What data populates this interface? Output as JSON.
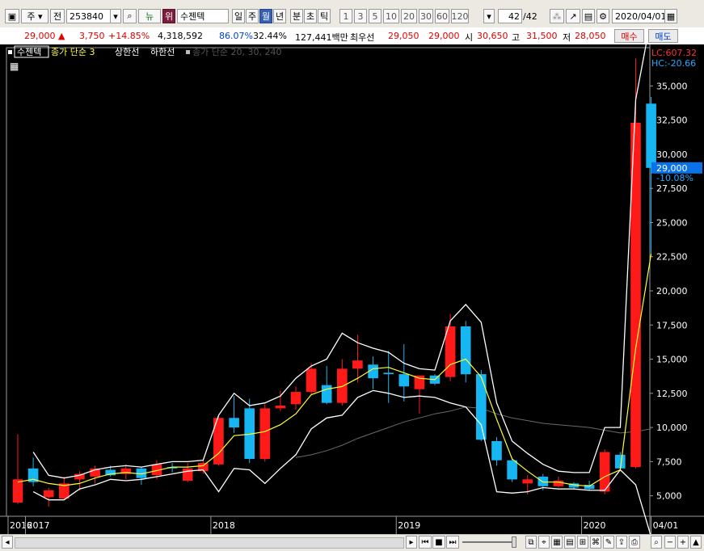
{
  "toolbar": {
    "period_type": "주",
    "prev_label": "전",
    "code": "253840",
    "news_label": "뉴",
    "flag_label": "위",
    "stock_name": "수젠텍",
    "periods": [
      "일",
      "주",
      "월",
      "년",
      "분",
      "초",
      "틱"
    ],
    "selected_period": "월",
    "numbers": [
      "1",
      "3",
      "5",
      "10",
      "20",
      "30",
      "60",
      "120"
    ],
    "count": "42",
    "count_total": "/42",
    "date": "2020/04/01"
  },
  "quote": {
    "price": "29,000",
    "change": "3,750",
    "change_pct": "+14.85%",
    "volume": "4,318,592",
    "ratio1": "86.07%",
    "ratio2": "32.44%",
    "amount": "127,441백만",
    "best_label": "최우선",
    "ask": "29,050",
    "bid": "29,000",
    "open_label": "시",
    "open": "30,650",
    "high_label": "고",
    "high": "31,500",
    "low_label": "저",
    "low": "28,050",
    "buy_label": "매수",
    "sell_label": "매도"
  },
  "colors": {
    "up": "#ff1a1a",
    "down": "#16b6f2",
    "ma": "#ffff33",
    "envelope": "#ffffff",
    "cursor_label_bg": "#0a72e8"
  },
  "chart_data": {
    "type": "candlestick",
    "legend": [
      "수젠텍",
      "종가 단순 3",
      "상한선",
      "하한선",
      "종가 단순 20, 30, 240"
    ],
    "lc_label": "LC:607.32",
    "hc_label": "HC:-20.66",
    "current_price_label": "29,000",
    "current_change_label": "-10.08%",
    "ylim": [
      3500,
      37800
    ],
    "y_ticks": [
      {
        "value": 5000,
        "label": "5,000"
      },
      {
        "value": 7500,
        "label": "7,500"
      },
      {
        "value": 10000,
        "label": "10,000"
      },
      {
        "value": 12500,
        "label": "12,500"
      },
      {
        "value": 15000,
        "label": "15,000"
      },
      {
        "value": 17500,
        "label": "17,500"
      },
      {
        "value": 20000,
        "label": "20,000"
      },
      {
        "value": 22500,
        "label": "22,500"
      },
      {
        "value": 25000,
        "label": "25,000"
      },
      {
        "value": 27500,
        "label": "27,500"
      },
      {
        "value": 30000,
        "label": "30,000"
      },
      {
        "value": 32500,
        "label": "32,500"
      },
      {
        "value": 35000,
        "label": "35,000"
      }
    ],
    "x_labels": [
      {
        "index": -1,
        "label": "2016"
      },
      {
        "index": 1,
        "label": "2017"
      },
      {
        "index": 13,
        "label": "2018"
      },
      {
        "index": 25,
        "label": "2019"
      },
      {
        "index": 37,
        "label": "2020"
      },
      {
        "index": 41.5,
        "label": "04/01"
      }
    ],
    "candles": [
      {
        "o": 4500,
        "h": 9500,
        "l": 4400,
        "c": 6200
      },
      {
        "o": 7000,
        "h": 7800,
        "l": 5700,
        "c": 6000
      },
      {
        "o": 4900,
        "h": 5600,
        "l": 4200,
        "c": 5400
      },
      {
        "o": 4800,
        "h": 6400,
        "l": 4700,
        "c": 5900
      },
      {
        "o": 6200,
        "h": 6800,
        "l": 5400,
        "c": 6600
      },
      {
        "o": 6400,
        "h": 7200,
        "l": 5900,
        "c": 7000
      },
      {
        "o": 6900,
        "h": 7200,
        "l": 6400,
        "c": 6500
      },
      {
        "o": 6600,
        "h": 7300,
        "l": 6200,
        "c": 7000
      },
      {
        "o": 7000,
        "h": 7100,
        "l": 5800,
        "c": 6300
      },
      {
        "o": 6500,
        "h": 7600,
        "l": 6200,
        "c": 7300
      },
      {
        "o": 7100,
        "h": 7400,
        "l": 6700,
        "c": 7000
      },
      {
        "o": 6100,
        "h": 7400,
        "l": 6000,
        "c": 7000
      },
      {
        "o": 6800,
        "h": 7600,
        "l": 6600,
        "c": 7400
      },
      {
        "o": 7300,
        "h": 10900,
        "l": 7200,
        "c": 10700
      },
      {
        "o": 10700,
        "h": 12300,
        "l": 9600,
        "c": 10000
      },
      {
        "o": 11400,
        "h": 12100,
        "l": 7400,
        "c": 7700
      },
      {
        "o": 7700,
        "h": 11700,
        "l": 7500,
        "c": 11400
      },
      {
        "o": 11400,
        "h": 12700,
        "l": 11200,
        "c": 11600
      },
      {
        "o": 11700,
        "h": 13000,
        "l": 11300,
        "c": 12600
      },
      {
        "o": 12600,
        "h": 14700,
        "l": 12400,
        "c": 14300
      },
      {
        "o": 13100,
        "h": 14500,
        "l": 11700,
        "c": 11800
      },
      {
        "o": 11800,
        "h": 15000,
        "l": 11600,
        "c": 14300
      },
      {
        "o": 14300,
        "h": 16800,
        "l": 13300,
        "c": 14900
      },
      {
        "o": 14600,
        "h": 15200,
        "l": 12800,
        "c": 13600
      },
      {
        "o": 14000,
        "h": 15600,
        "l": 11800,
        "c": 13900
      },
      {
        "o": 13900,
        "h": 16100,
        "l": 11900,
        "c": 13000
      },
      {
        "o": 12800,
        "h": 13800,
        "l": 11000,
        "c": 13800
      },
      {
        "o": 13800,
        "h": 13900,
        "l": 13100,
        "c": 13200
      },
      {
        "o": 13700,
        "h": 18300,
        "l": 13400,
        "c": 17400
      },
      {
        "o": 17400,
        "h": 17800,
        "l": 13300,
        "c": 13900
      },
      {
        "o": 13900,
        "h": 14200,
        "l": 9000,
        "c": 9100
      },
      {
        "o": 9000,
        "h": 9300,
        "l": 7200,
        "c": 7600
      },
      {
        "o": 7600,
        "h": 7800,
        "l": 6000,
        "c": 6200
      },
      {
        "o": 5900,
        "h": 6500,
        "l": 5100,
        "c": 6200
      },
      {
        "o": 6400,
        "h": 6600,
        "l": 5400,
        "c": 5700
      },
      {
        "o": 5700,
        "h": 6400,
        "l": 5600,
        "c": 6100
      },
      {
        "o": 5900,
        "h": 6000,
        "l": 5500,
        "c": 5600
      },
      {
        "o": 5800,
        "h": 6100,
        "l": 5400,
        "c": 5500
      },
      {
        "o": 5300,
        "h": 8400,
        "l": 5100,
        "c": 8200
      },
      {
        "o": 8000,
        "h": 8200,
        "l": 6800,
        "c": 7000
      },
      {
        "o": 7100,
        "h": 37000,
        "l": 7000,
        "c": 32300
      },
      {
        "o": 33700,
        "h": 34200,
        "l": 22700,
        "c": 29000
      }
    ],
    "ma3": [
      6000,
      6200,
      5900,
      5750,
      5900,
      6300,
      6600,
      6700,
      6600,
      6850,
      7100,
      7100,
      7200,
      8100,
      9400,
      9500,
      9700,
      10200,
      11000,
      12400,
      12800,
      13000,
      13600,
      14300,
      14400,
      14000,
      13600,
      13500,
      14600,
      15000,
      13700,
      10600,
      7700,
      6800,
      6000,
      6000,
      5800,
      5700,
      6400,
      6900,
      15800,
      22700
    ],
    "upper": [
      null,
      8200,
      6500,
      6300,
      6500,
      6900,
      7100,
      7200,
      7100,
      7300,
      7500,
      7500,
      7600,
      10900,
      12500,
      11600,
      11800,
      12300,
      13600,
      14500,
      15000,
      16900,
      16200,
      15800,
      15500,
      14700,
      14300,
      14200,
      17800,
      19000,
      17700,
      11800,
      9000,
      8100,
      7300,
      6800,
      6700,
      6700,
      10000,
      10000,
      34000,
      40000
    ],
    "lower": [
      null,
      5300,
      4700,
      4700,
      5500,
      5800,
      6200,
      6100,
      6200,
      6400,
      6600,
      6800,
      6900,
      5300,
      7000,
      6900,
      5900,
      7000,
      8000,
      9900,
      10700,
      10900,
      12200,
      12700,
      12500,
      12200,
      12300,
      12200,
      11800,
      11500,
      10200,
      5300,
      5200,
      5300,
      5600,
      5500,
      5500,
      5400,
      5400,
      6900,
      5800,
      2000
    ],
    "slow_ma": [
      null,
      null,
      null,
      null,
      null,
      null,
      null,
      null,
      null,
      null,
      null,
      null,
      null,
      null,
      null,
      null,
      null,
      null,
      7800,
      8000,
      8300,
      8700,
      9200,
      9600,
      10000,
      10400,
      10700,
      11000,
      11200,
      11500,
      11400,
      11000,
      10700,
      10500,
      10300,
      10200,
      10100,
      10000,
      9800,
      9600,
      9700,
      9900
    ]
  }
}
